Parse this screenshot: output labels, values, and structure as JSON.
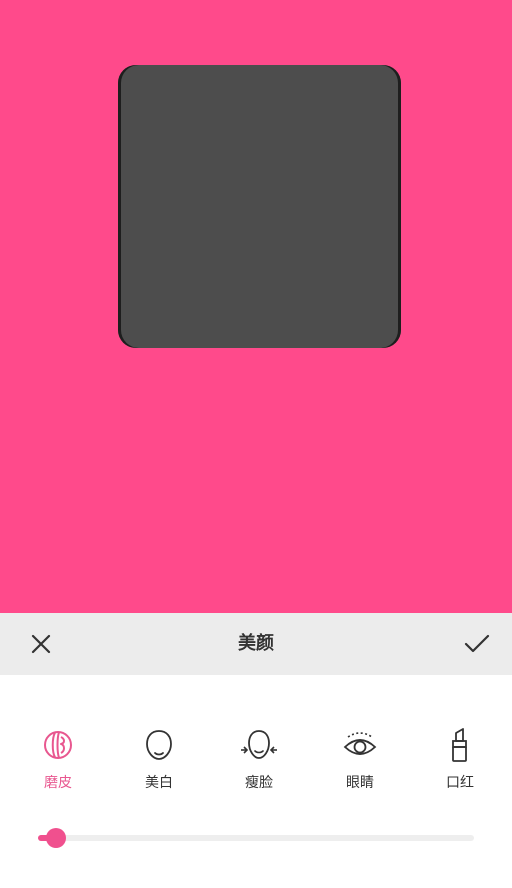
{
  "header": {
    "title": "美颜",
    "close_icon": "close-icon",
    "confirm_icon": "checkmark-icon"
  },
  "colors": {
    "background": "#ff4a8b",
    "accent": "#e8578f",
    "toolbar": "#ececec",
    "preview_image": "#4d4d4d"
  },
  "tools": [
    {
      "label": "磨皮",
      "icon": "skin-smooth-icon",
      "active": true
    },
    {
      "label": "美白",
      "icon": "face-whiten-icon",
      "active": false
    },
    {
      "label": "瘦脸",
      "icon": "slim-face-icon",
      "active": false
    },
    {
      "label": "眼睛",
      "icon": "eye-icon",
      "active": false
    },
    {
      "label": "口红",
      "icon": "lipstick-icon",
      "active": false
    }
  ],
  "slider": {
    "value": 0.02
  }
}
